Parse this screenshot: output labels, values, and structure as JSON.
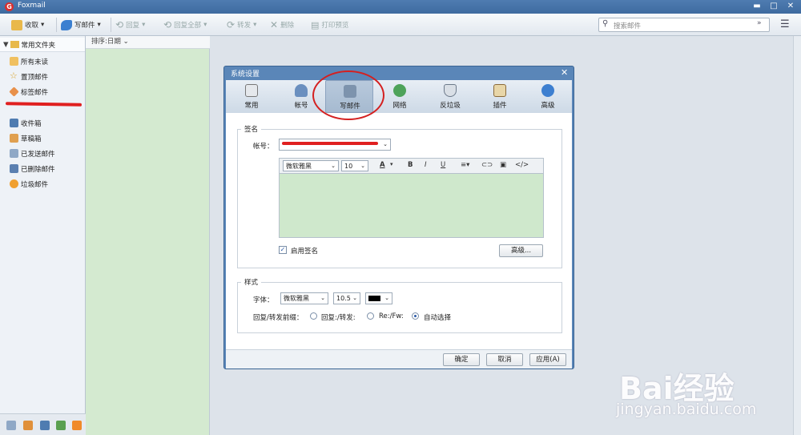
{
  "app": {
    "title": "Foxmail"
  },
  "toolbar": {
    "receive": "收取",
    "compose": "写邮件",
    "reply": "回复",
    "reply_all": "回复全部",
    "forward": "转发",
    "delete": "删除",
    "print_preview": "打印预览",
    "search_placeholder": "搜索邮件"
  },
  "sidebar": {
    "header": "常用文件夹",
    "items": [
      {
        "label": "所有未读",
        "icon": "folder-icon"
      },
      {
        "label": "置顶邮件",
        "icon": "star-icon"
      },
      {
        "label": "标签邮件",
        "icon": "tag-icon"
      }
    ],
    "account_items": [
      {
        "label": "收件箱",
        "icon": "inbox-icon"
      },
      {
        "label": "草稿箱",
        "icon": "draft-icon"
      },
      {
        "label": "已发送邮件",
        "icon": "sent-icon"
      },
      {
        "label": "已删除邮件",
        "icon": "trash-icon"
      },
      {
        "label": "垃圾邮件",
        "icon": "junk-icon"
      }
    ]
  },
  "maillist": {
    "sort_label": "排序:日期"
  },
  "dialog": {
    "title": "系统设置",
    "tabs": [
      {
        "label": "常用",
        "icon": "general-icon"
      },
      {
        "label": "帐号",
        "icon": "account-icon"
      },
      {
        "label": "写邮件",
        "icon": "compose-icon"
      },
      {
        "label": "网络",
        "icon": "network-icon"
      },
      {
        "label": "反垃圾",
        "icon": "antispam-icon"
      },
      {
        "label": "插件",
        "icon": "plugin-icon"
      },
      {
        "label": "高级",
        "icon": "advanced-icon"
      }
    ],
    "active_tab": "写邮件",
    "signature": {
      "legend": "签名",
      "account_label": "帐号：",
      "font_value": "微软雅黑",
      "size_value": "10",
      "enable_label": "启用签名",
      "advanced_button": "高级..."
    },
    "style": {
      "legend": "样式",
      "font_label": "字体：",
      "font_value": "微软雅黑",
      "size_value": "10.5",
      "prefix_label": "回复/转发前缀：",
      "option1": "回复:/转发:",
      "option2": "Re:/Fw:",
      "option3": "自动选择",
      "selected_option": "自动选择"
    },
    "buttons": {
      "ok": "确定",
      "cancel": "取消",
      "apply": "应用(A)"
    }
  },
  "watermark": {
    "brand": "Bai经验",
    "url": "jingyan.baidu.com"
  },
  "colors": {
    "accent": "#4f7cb1",
    "list_bg": "#d4ead0",
    "annotation": "#d42020"
  }
}
